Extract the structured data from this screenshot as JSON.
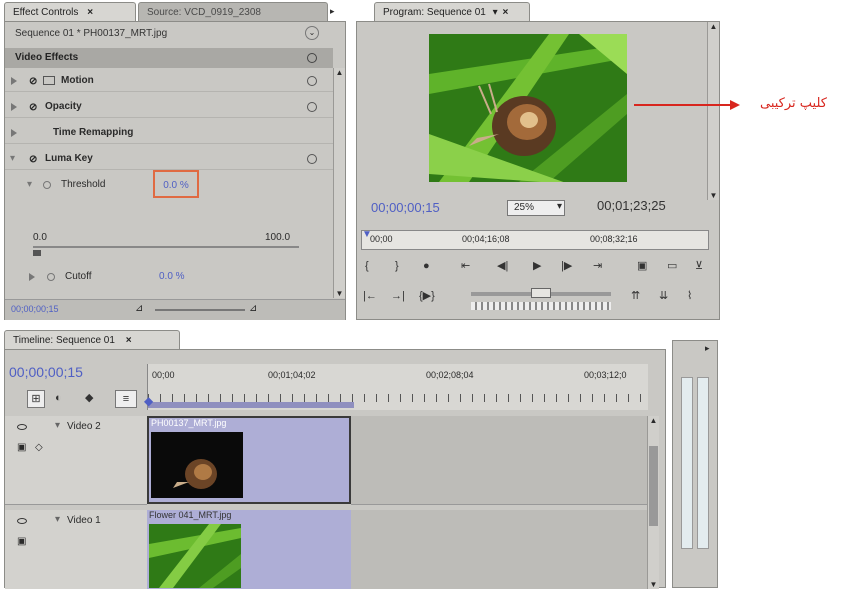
{
  "effect_controls": {
    "tab_effect": "Effect Controls",
    "tab_source": "Source: VCD_0919_2308",
    "sequence_clip": "Sequence 01 * PH00137_MRT.jpg",
    "header": "Video Effects",
    "effects": [
      {
        "label": "Motion"
      },
      {
        "label": "Opacity"
      },
      {
        "label": "Time Remapping"
      },
      {
        "label": "Luma Key"
      }
    ],
    "threshold_label": "Threshold",
    "threshold_value": "0.0 %",
    "slider_min": "0.0",
    "slider_max": "100.0",
    "cutoff_label": "Cutoff",
    "cutoff_value": "0.0 %",
    "footer_timecode": "00;00;00;15"
  },
  "program": {
    "tab": "Program: Sequence 01",
    "timecode_current": "00;00;00;15",
    "zoom": "25%",
    "timecode_duration": "00;01;23;25",
    "ruler": [
      "00;00",
      "00;04;16;08",
      "00;08;32;16"
    ]
  },
  "annotation": {
    "text": "کلیپ ترکیبی",
    "color": "#d8261e"
  },
  "timeline": {
    "tab": "Timeline: Sequence 01",
    "timecode": "00;00;00;15",
    "ruler": [
      "00;00",
      "00;01;04;02",
      "00;02;08;04",
      "00;03;12;0"
    ],
    "tracks": [
      {
        "name": "Video 2",
        "clip": "PH00137_MRT.jpg"
      },
      {
        "name": "Video 1",
        "clip": "Flower 041_MRT.jpg"
      }
    ]
  },
  "colors": {
    "panel": "#c9c8c4",
    "timecode_blue": "#4f5fc4",
    "clip_purple": "#aeaed6",
    "highlight_red": "#d8261e"
  }
}
